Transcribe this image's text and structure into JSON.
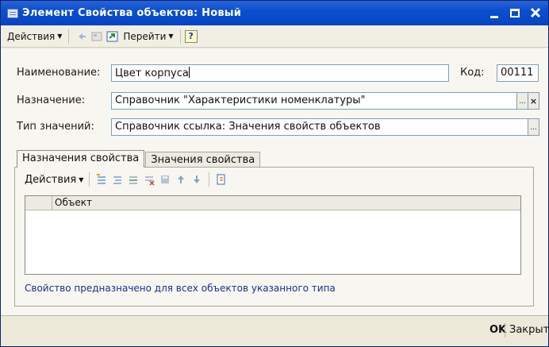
{
  "window": {
    "title": "Элемент Свойства объектов: Новый",
    "title_bar_color": "#0a4fd0"
  },
  "toolbar": {
    "actions_label": "Действия",
    "goto_label": "Перейти",
    "help_label": "?"
  },
  "form": {
    "name_label": "Наименование:",
    "name_value": "Цвет корпуса",
    "code_label": "Код:",
    "code_value": "00111",
    "purpose_label": "Назначение:",
    "purpose_value": "Справочник  \"Характеристики номенклатуры\"",
    "type_label": "Тип значений:",
    "type_value": "Справочник ссылка: Значения свойств объектов",
    "pick_button": "...",
    "clear_button": "×"
  },
  "tabs": [
    {
      "label": "Назначения свойства",
      "active": true
    },
    {
      "label": "Значения свойства",
      "active": false
    }
  ],
  "panel": {
    "actions_label": "Действия",
    "table_columns": [
      "Объект"
    ],
    "table_rows": [],
    "hint": "Свойство предназначено для всех объектов указанного типа",
    "hint_color": "#1f2f8a"
  },
  "footer": {
    "ok_label": "OK",
    "close_label": "Закрыть"
  }
}
